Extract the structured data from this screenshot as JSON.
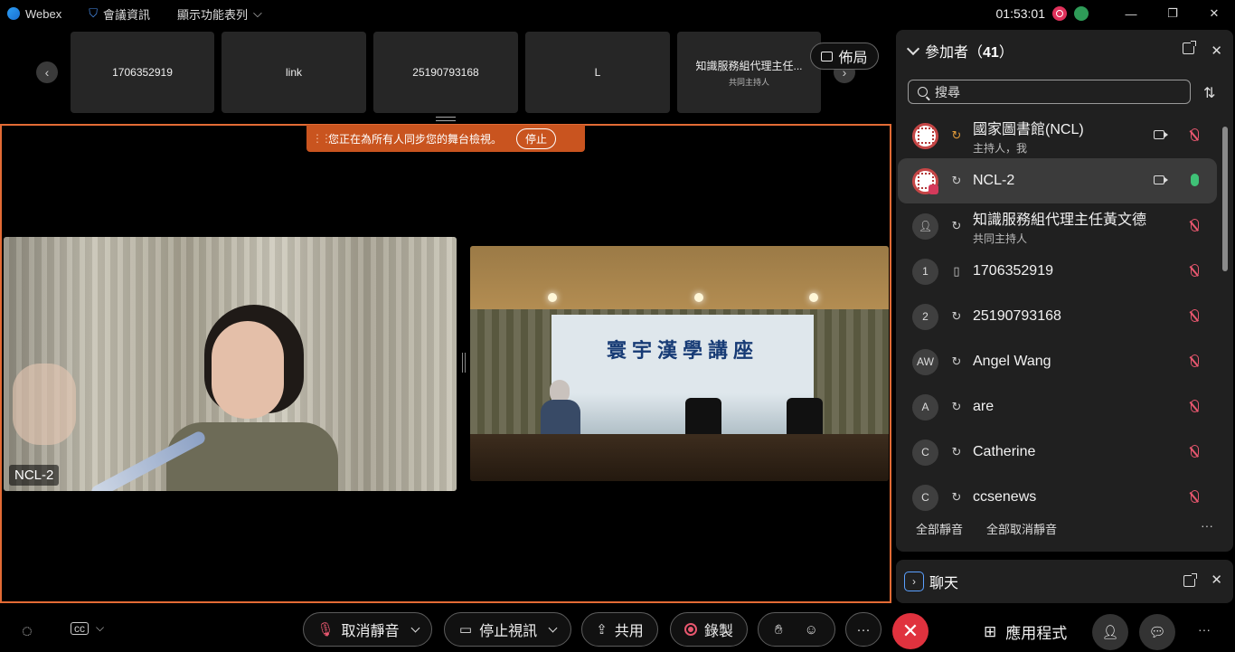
{
  "titlebar": {
    "app_name": "Webex",
    "meeting_info": "會議資訊",
    "view_menu": "顯示功能表列",
    "clock": "01:53:01"
  },
  "strip": {
    "prev": "‹",
    "next": "›",
    "thumbs": [
      {
        "label": "1706352919",
        "sub": ""
      },
      {
        "label": "link",
        "sub": ""
      },
      {
        "label": "25190793168",
        "sub": ""
      },
      {
        "label": "L",
        "sub": ""
      },
      {
        "label": "知識服務組代理主任...",
        "sub": "共同主持人"
      }
    ],
    "layout_label": "佈局"
  },
  "stage": {
    "sync_text": "您正在為所有人同步您的舞台檢視。",
    "stop_label": "停止",
    "video1_name": "NCL-2",
    "banner_title": "寰宇漢學講座"
  },
  "participants": {
    "title": "參加者（",
    "count": "41",
    "title_end": "）",
    "search_placeholder": "搜尋",
    "rows": [
      {
        "avatar": "",
        "name": "國家圖書館(NCL)",
        "role": "主持人，我"
      },
      {
        "avatar": "",
        "name": "NCL-2",
        "role": ""
      },
      {
        "avatar": "",
        "name": "知識服務組代理主任黃文德",
        "role": "共同主持人"
      },
      {
        "avatar": "1",
        "name": "1706352919",
        "role": ""
      },
      {
        "avatar": "2",
        "name": "25190793168",
        "role": ""
      },
      {
        "avatar": "AW",
        "name": "Angel Wang",
        "role": ""
      },
      {
        "avatar": "A",
        "name": "are",
        "role": ""
      },
      {
        "avatar": "C",
        "name": "Catherine",
        "role": ""
      },
      {
        "avatar": "C",
        "name": "ccsenews",
        "role": ""
      }
    ],
    "mute_all": "全部靜音",
    "unmute_all": "全部取消靜音",
    "more": "···"
  },
  "chat": {
    "title": "聊天"
  },
  "controls": {
    "unmute": "取消靜音",
    "stop_video": "停止視訊",
    "share": "共用",
    "record": "錄製",
    "apps": "應用程式"
  }
}
